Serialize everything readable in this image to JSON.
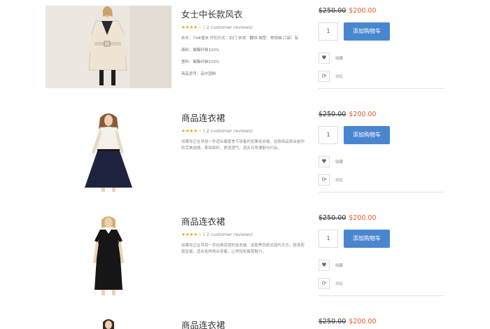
{
  "products": [
    {
      "title": "女士中长款风衣",
      "reviews": "( 2 customer reviews)",
      "specs": [
        "衣长：74#厘米 开扣方式：扣门 衣领：翻领 袖型：常规袖 口袋：有",
        "面料：聚酯纤维100%",
        "里料：聚酯纤维100%",
        "商品货号：品中国制"
      ],
      "old_price": "$250.00",
      "new_price": "$200.00",
      "qty": "1",
      "cart_label": "添加购物车",
      "wish_label": "收藏",
      "compare_label": "对比"
    },
    {
      "title": "商品连衣裙",
      "reviews": "( 2 customer reviews)",
      "desc": "如果你正在寻找一件适合春夏季节穿着的优雅连衣裙，这款商品将会是你的完美选择。柔软面料，舒适透气，适合日常通勤与约会。",
      "old_price": "$250.00",
      "new_price": "$200.00",
      "qty": "1",
      "cart_label": "添加购物车",
      "wish_label": "收藏",
      "compare_label": "对比"
    },
    {
      "title": "商品连衣裙",
      "reviews": "( 2 customer reviews)",
      "desc": "如果你正在寻找一件经典百搭的连衣裙，这款黑色款式简约大方，修身剪裁显瘦，适合各种场合穿着，让你轻松展现魅力。",
      "old_price": "$250.00",
      "new_price": "$200.00",
      "qty": "1",
      "cart_label": "添加购物车",
      "wish_label": "收藏",
      "compare_label": "对比"
    },
    {
      "title": "商品连衣裙",
      "old_price": "$250.00",
      "new_price": "$200.00"
    }
  ],
  "rating_value": 4,
  "rating_max": 5,
  "colors": {
    "accent": "#4a86cf",
    "price_new": "#e05a2b",
    "star": "#f0a020"
  }
}
